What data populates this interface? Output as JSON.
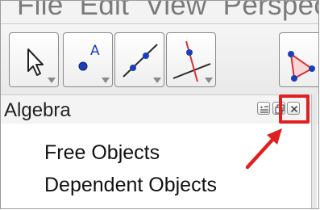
{
  "menubar": {
    "text": "File  Edit  View  Perspecti"
  },
  "toolbar": {
    "tools": [
      {
        "name": "move-tool",
        "icon": "arrow-cursor-icon"
      },
      {
        "name": "point-tool",
        "icon": "point-icon",
        "label": "A"
      },
      {
        "name": "line-tool",
        "icon": "line-through-two-points-icon"
      },
      {
        "name": "perpendicular-line-tool",
        "icon": "perpendicular-line-icon"
      },
      {
        "name": "polygon-tool",
        "icon": "polygon-icon"
      }
    ]
  },
  "algebra": {
    "title": "Algebra",
    "buttons": [
      "style-bar-toggle-icon",
      "undock-icon",
      "close-icon"
    ],
    "items": [
      "Free Objects",
      "Dependent Objects"
    ]
  },
  "colors": {
    "highlight": "#e02020",
    "point": "#1b3fb8",
    "line": "#2a2a2a"
  }
}
